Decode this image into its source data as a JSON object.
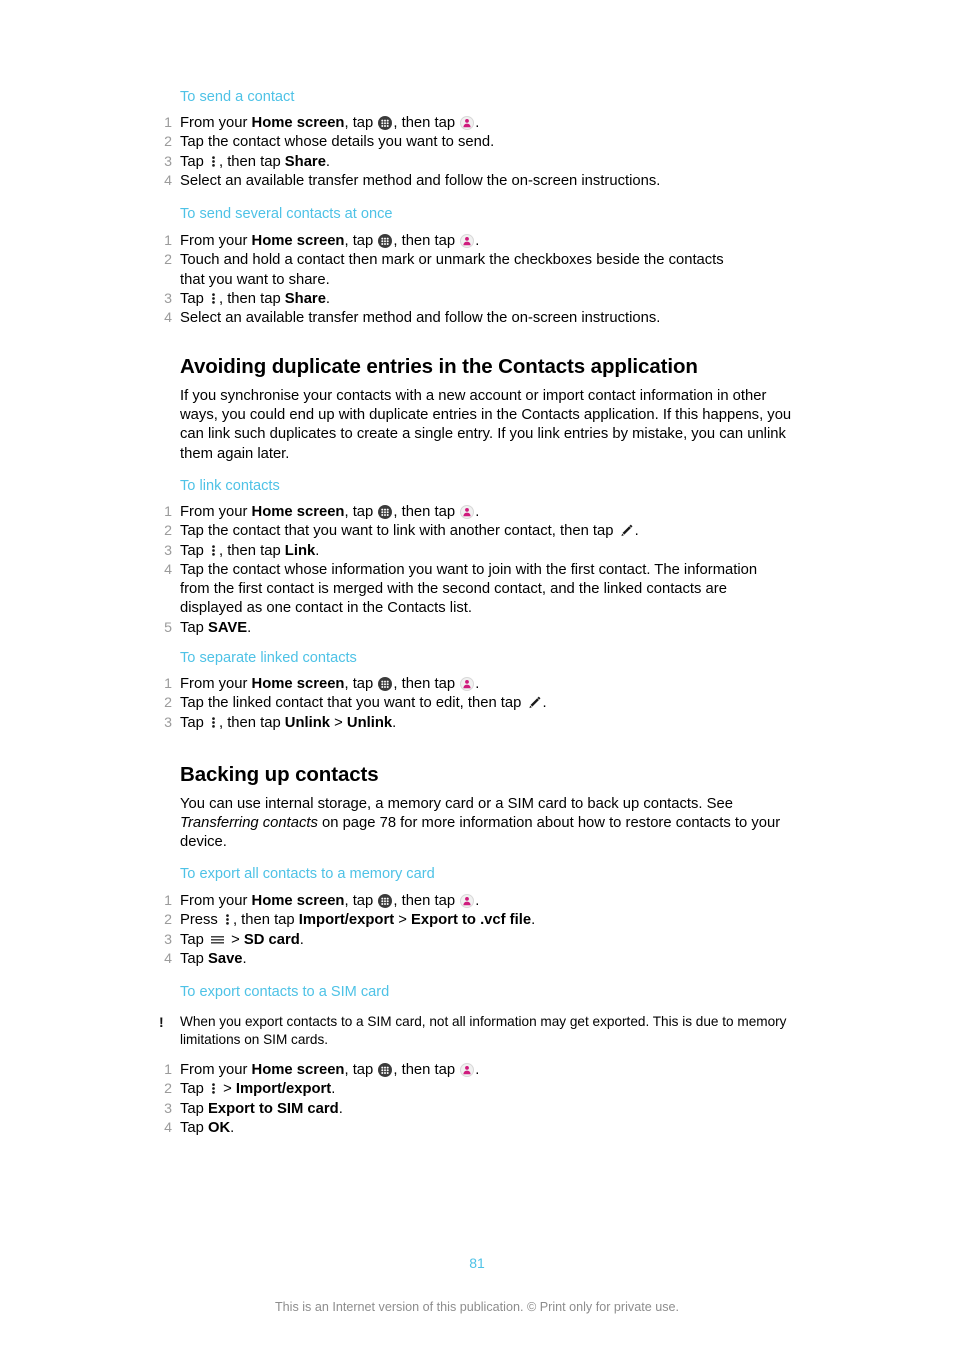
{
  "document": {
    "page_number": "81",
    "footer_note": "This is an Internet version of this publication. © Print only for private use.",
    "accent_color": "#4ec2e6",
    "step_number_color": "#9b9b9b",
    "footer_color": "#8d8d8d"
  },
  "icons": {
    "app_drawer": "app-drawer-icon",
    "contacts": "contacts-icon",
    "overflow_menu": "overflow-menu-icon",
    "hamburger": "hamburger-menu-icon",
    "pencil": "pencil-edit-icon",
    "warning": "!"
  },
  "sections": {
    "send_contact": {
      "title": "To send a contact",
      "steps": {
        "s1_a": "From your ",
        "s1_b": "Home screen",
        "s1_c": ", tap ",
        "s1_d": ", then tap ",
        "s1_e": ".",
        "s2": "Tap the contact whose details you want to send.",
        "s3_a": "Tap ",
        "s3_b": ", then tap ",
        "s3_c": "Share",
        "s3_d": ".",
        "s4": "Select an available transfer method and follow the on-screen instructions."
      }
    },
    "send_several": {
      "title": "To send several contacts at once",
      "steps": {
        "s1_a": "From your ",
        "s1_b": "Home screen",
        "s1_c": ", tap ",
        "s1_d": ", then tap ",
        "s1_e": ".",
        "s2": "Touch and hold a contact then mark or unmark the checkboxes beside the contacts that you want to share.",
        "s3_a": "Tap ",
        "s3_b": ", then tap ",
        "s3_c": "Share",
        "s3_d": ".",
        "s4": "Select an available transfer method and follow the on-screen instructions."
      }
    },
    "avoiding_duplicates": {
      "title": "Avoiding duplicate entries in the Contacts application",
      "paragraph": "If you synchronise your contacts with a new account or import contact information in other ways, you could end up with duplicate entries in the Contacts application. If this happens, you can link such duplicates to create a single entry. If you link entries by mistake, you can unlink them again later."
    },
    "link_contacts": {
      "title": "To link contacts",
      "steps": {
        "s1_a": "From your ",
        "s1_b": "Home screen",
        "s1_c": ", tap ",
        "s1_d": ", then tap ",
        "s1_e": ".",
        "s2_a": "Tap the contact that you want to link with another contact, then tap ",
        "s2_b": ".",
        "s3_a": "Tap ",
        "s3_b": ", then tap ",
        "s3_c": "Link",
        "s3_d": ".",
        "s4": "Tap the contact whose information you want to join with the first contact. The information from the first contact is merged with the second contact, and the linked contacts are displayed as one contact in the Contacts list.",
        "s5_a": "Tap ",
        "s5_b": "SAVE",
        "s5_c": "."
      }
    },
    "separate_linked": {
      "title": "To separate linked contacts",
      "steps": {
        "s1_a": "From your ",
        "s1_b": "Home screen",
        "s1_c": ", tap ",
        "s1_d": ", then tap ",
        "s1_e": ".",
        "s2_a": "Tap the linked contact that you want to edit, then tap ",
        "s2_b": ".",
        "s3_a": "Tap ",
        "s3_b": ", then tap ",
        "s3_c": "Unlink",
        "s3_d": " > ",
        "s3_e": "Unlink",
        "s3_f": "."
      }
    },
    "backing_up": {
      "title": "Backing up contacts",
      "para_a": "You can use internal storage, a memory card or a SIM card to back up contacts. See ",
      "para_italic": "Transferring contacts",
      "para_b": " on page 78 for more information about how to restore contacts to your device."
    },
    "export_memory_card": {
      "title": "To export all contacts to a memory card",
      "steps": {
        "s1_a": "From your ",
        "s1_b": "Home screen",
        "s1_c": ", tap ",
        "s1_d": ", then tap ",
        "s1_e": ".",
        "s2_a": "Press ",
        "s2_b": ", then tap ",
        "s2_c": "Import/export",
        "s2_d": " > ",
        "s2_e": "Export to .vcf file",
        "s2_f": ".",
        "s3_a": "Tap ",
        "s3_b": " > ",
        "s3_c": "SD card",
        "s3_d": ".",
        "s4_a": "Tap ",
        "s4_b": "Save",
        "s4_c": "."
      }
    },
    "export_sim": {
      "title": "To export contacts to a SIM card",
      "note": "When you export contacts to a SIM card, not all information may get exported. This is due to memory limitations on SIM cards.",
      "steps": {
        "s1_a": "From your ",
        "s1_b": "Home screen",
        "s1_c": ", tap ",
        "s1_d": ", then tap ",
        "s1_e": ".",
        "s2_a": "Tap ",
        "s2_b": " > ",
        "s2_c": "Import/export",
        "s2_d": ".",
        "s3_a": "Tap ",
        "s3_b": "Export to SIM card",
        "s3_c": ".",
        "s4_a": "Tap ",
        "s4_b": "OK",
        "s4_c": "."
      }
    }
  }
}
